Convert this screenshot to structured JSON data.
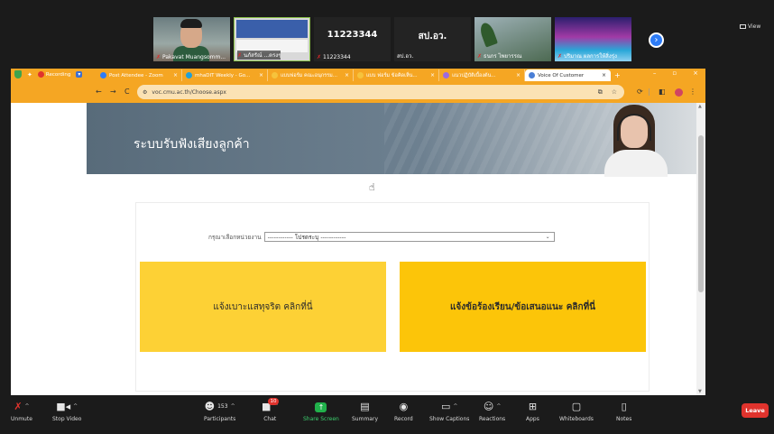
{
  "zoom": {
    "gallery": [
      {
        "kind": "video",
        "name": "Pakavat Muangsomm..."
      },
      {
        "kind": "share",
        "name": "นภัสรัณ์ ...ตรงๆ"
      },
      {
        "kind": "text",
        "big": "11223344",
        "name": "11223344"
      },
      {
        "kind": "text",
        "big": "สป.อว.",
        "name": "สป.อว."
      },
      {
        "kind": "plant",
        "name": "ธนกร ไพยารรณ"
      },
      {
        "kind": "sky",
        "name": "ปริมาณ ผลการให้สิ่งรุ่ง"
      }
    ],
    "view_label": "View",
    "toolbar": {
      "unmute": "Unmute",
      "stop_video": "Stop Video",
      "participants": "Participants",
      "participants_count": "153",
      "chat": "Chat",
      "chat_badge": "10",
      "share_screen": "Share Screen",
      "summary": "Summary",
      "record": "Record",
      "show_captions": "Show Captions",
      "reactions": "Reactions",
      "apps": "Apps",
      "whiteboards": "Whiteboards",
      "notes": "Notes",
      "leave": "Leave"
    },
    "colors": {
      "leave": "#e0332d",
      "share": "#21b14b",
      "brand_blue": "#2d7cf6"
    }
  },
  "browser": {
    "recording_label": "Recording",
    "tabs": [
      {
        "title": "Post Attendee - Zoom",
        "color": "#2d7cf6"
      },
      {
        "title": "mhaDIT Weekly - Go...",
        "color": "#21a0d8"
      },
      {
        "title": "แบบฟอร์ม คณะอนุกรรม...",
        "color": "#f6c33c"
      },
      {
        "title": "แบบ ฟอร์ม ข้อคิดเห็น...",
        "color": "#f6c33c"
      },
      {
        "title": "แนวปฏิบัติเบื้องต้น...",
        "color": "#9c6ade"
      },
      {
        "title": "Voice Of Customer",
        "color": "#4a7fd6"
      }
    ],
    "url": "voc.cmu.ac.th/Choose.aspx",
    "accent": "#f5a623"
  },
  "page": {
    "banner_title": "ระบบรับฟังเสียงลูกค้า",
    "select_label": "กรุณาเลือกหน่วยงาน",
    "select_value": "------------ โปรดระบุ ------------",
    "option_fraud": "แจ้งเบาะแสทุจริต คลิกที่นี่",
    "option_complaint": "แจ้งข้อร้องเรียน/ข้อเสนอแนะ คลิกที่นี่",
    "colors": {
      "option_a": "#fdd135",
      "option_b": "#fcc509"
    }
  }
}
